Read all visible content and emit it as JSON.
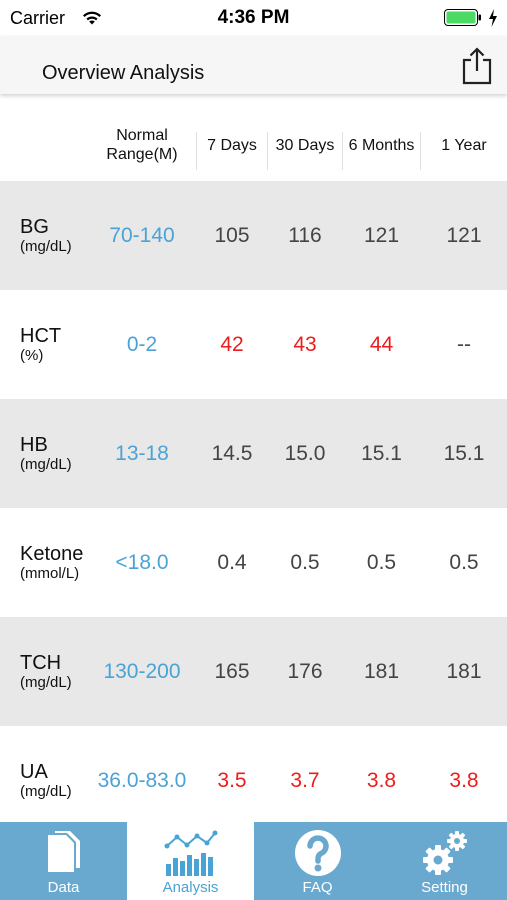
{
  "status_bar": {
    "carrier": "Carrier",
    "time": "4:36 PM"
  },
  "header": {
    "title": "Overview Analysis",
    "share_icon": "share-icon"
  },
  "table": {
    "columns": [
      "Normal Range(M)",
      "7 Days",
      "30 Days",
      "6 Months",
      "1 Year"
    ],
    "rows": [
      {
        "name": "BG",
        "unit": "(mg/dL)",
        "range": "70-140",
        "values": [
          "105",
          "116",
          "121",
          "121"
        ],
        "flags": [
          false,
          false,
          false,
          false
        ]
      },
      {
        "name": "HCT",
        "unit": "(%)",
        "range": "0-2",
        "values": [
          "42",
          "43",
          "44",
          "--"
        ],
        "flags": [
          true,
          true,
          true,
          false
        ]
      },
      {
        "name": "HB",
        "unit": "(mg/dL)",
        "range": "13-18",
        "values": [
          "14.5",
          "15.0",
          "15.1",
          "15.1"
        ],
        "flags": [
          false,
          false,
          false,
          false
        ]
      },
      {
        "name": "Ketone",
        "unit": "(mmol/L)",
        "range": "<18.0",
        "values": [
          "0.4",
          "0.5",
          "0.5",
          "0.5"
        ],
        "flags": [
          false,
          false,
          false,
          false
        ]
      },
      {
        "name": "TCH",
        "unit": "(mg/dL)",
        "range": "130-200",
        "values": [
          "165",
          "176",
          "181",
          "181"
        ],
        "flags": [
          false,
          false,
          false,
          false
        ]
      },
      {
        "name": "UA",
        "unit": "(mg/dL)",
        "range": "36.0-83.0",
        "values": [
          "3.5",
          "3.7",
          "3.8",
          "3.8"
        ],
        "flags": [
          true,
          true,
          true,
          true
        ]
      }
    ]
  },
  "tabbar": {
    "tabs": [
      {
        "label": "Data",
        "icon": "data-icon",
        "active": false
      },
      {
        "label": "Analysis",
        "icon": "analysis-icon",
        "active": true
      },
      {
        "label": "FAQ",
        "icon": "faq-icon",
        "active": false
      },
      {
        "label": "Setting",
        "icon": "setting-icon",
        "active": false
      }
    ]
  },
  "colors": {
    "range_blue": "#4aa3d5",
    "high_red": "#ee1c1c",
    "tabbar_blue": "#6aa9cf",
    "row_shade": "#e8e8e8"
  }
}
